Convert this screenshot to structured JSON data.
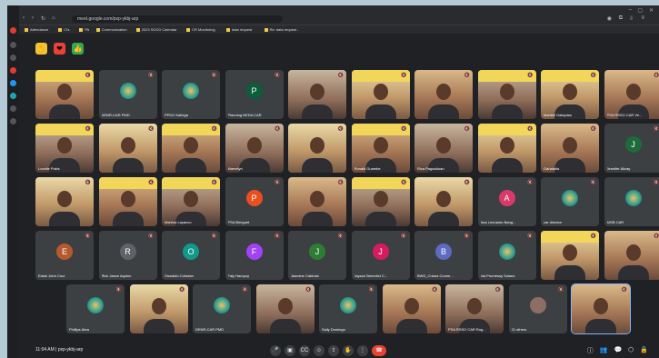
{
  "browser": {
    "url": "meet.google.com/pxp-ykbj-arp",
    "bookmarks": [
      "Attendance",
      "Cl's",
      "PA",
      "Communication",
      "2023 SOCD Calendar",
      "CR Monitoring",
      "data request",
      "Re: data request -"
    ]
  },
  "reactions": [
    {
      "name": "raise-hand",
      "color": "#f4c430",
      "glyph": "✋"
    },
    {
      "name": "heart",
      "color": "#ea4335",
      "glyph": "❤"
    },
    {
      "name": "thumbs",
      "color": "#34a853",
      "glyph": "👍"
    }
  ],
  "participants_row1": [
    {
      "name": "",
      "kind": "video",
      "banner": true
    },
    {
      "name": "DENR-CAR PMD",
      "kind": "logo"
    },
    {
      "name": "PPDO Kalinga",
      "kind": "logo"
    },
    {
      "name": "Planning NEDA CAR",
      "kind": "avatar",
      "initial": "P",
      "color": "#0b5d3b"
    },
    {
      "name": "",
      "kind": "video"
    },
    {
      "name": "",
      "kind": "video",
      "banner": true
    },
    {
      "name": "",
      "kind": "video"
    },
    {
      "name": "",
      "kind": "video",
      "banner": true
    },
    {
      "name": "Maribel Dalaydao",
      "kind": "video",
      "banner": true
    },
    {
      "name": "PSA RSSO CAR Ve...",
      "kind": "video"
    }
  ],
  "participants_row2": [
    {
      "name": "Lovelle Pokis",
      "kind": "video",
      "banner": true
    },
    {
      "name": "",
      "kind": "video"
    },
    {
      "name": "",
      "kind": "video",
      "banner": true
    },
    {
      "name": "Marvelyn",
      "kind": "video"
    },
    {
      "name": "",
      "kind": "video"
    },
    {
      "name": "Ronald Guambe",
      "kind": "video",
      "banner": true
    },
    {
      "name": "Rica Pagadduan",
      "kind": "video"
    },
    {
      "name": "",
      "kind": "video",
      "banner": true
    },
    {
      "name": "Gahatalla",
      "kind": "video"
    },
    {
      "name": "Jennifer Alicay",
      "kind": "avatar",
      "initial": "J",
      "color": "#1e6b3a"
    }
  ],
  "participants_row3": [
    {
      "name": "",
      "kind": "video"
    },
    {
      "name": "",
      "kind": "video",
      "banner": true
    },
    {
      "name": "Marrica Layanco",
      "kind": "video",
      "banner": true
    },
    {
      "name": "PSA Benguet",
      "kind": "avatar",
      "initial": "P",
      "color": "#e8501f"
    },
    {
      "name": "",
      "kind": "video"
    },
    {
      "name": "",
      "kind": "video",
      "banner": true
    },
    {
      "name": "",
      "kind": "video"
    },
    {
      "name": "Ana Leonardo Bang...",
      "kind": "avatar",
      "initial": "A",
      "color": "#d93a6a"
    },
    {
      "name": "car director",
      "kind": "logo"
    },
    {
      "name": "MGB CAR",
      "kind": "logo"
    }
  ],
  "participants_row4": [
    {
      "name": "Edsel John Cruz",
      "kind": "avatar",
      "initial": "E",
      "color": "#b55a2c"
    },
    {
      "name": "Rick Jason Aquino",
      "kind": "avatar",
      "initial": "R",
      "color": "#5f6368"
    },
    {
      "name": "Oswaldo Cofodan",
      "kind": "avatar",
      "initial": "O",
      "color": "#12998a"
    },
    {
      "name": "Faly Hampuy",
      "kind": "avatar",
      "initial": "F",
      "color": "#a142f4"
    },
    {
      "name": "Jasmine Cabirian",
      "kind": "avatar",
      "initial": "J",
      "color": "#2e7d32"
    },
    {
      "name": "Jayson Benedict C...",
      "kind": "avatar",
      "initial": "J",
      "color": "#d81b60"
    },
    {
      "name": "BWD_Criana Conne...",
      "kind": "avatar",
      "initial": "B",
      "color": "#5c6bc0"
    },
    {
      "name": "Ida Promessy Solano",
      "kind": "logo"
    },
    {
      "name": "",
      "kind": "video",
      "banner": true
    },
    {
      "name": "",
      "kind": "video"
    }
  ],
  "participants_row5": [
    {
      "name": "Phillips Abra",
      "kind": "logo"
    },
    {
      "name": "",
      "kind": "video"
    },
    {
      "name": "DENR-CAR PMD",
      "kind": "logo"
    },
    {
      "name": "",
      "kind": "video"
    },
    {
      "name": "Sally Domingo",
      "kind": "logo"
    },
    {
      "name": "",
      "kind": "video"
    },
    {
      "name": "PSA RSSO CAR Rug...",
      "kind": "video"
    },
    {
      "name": "21 others",
      "kind": "others"
    },
    {
      "name": "",
      "kind": "video"
    }
  ],
  "bottom": {
    "time_meeting": "11:04 AM | pxp-ykbj-arp"
  }
}
